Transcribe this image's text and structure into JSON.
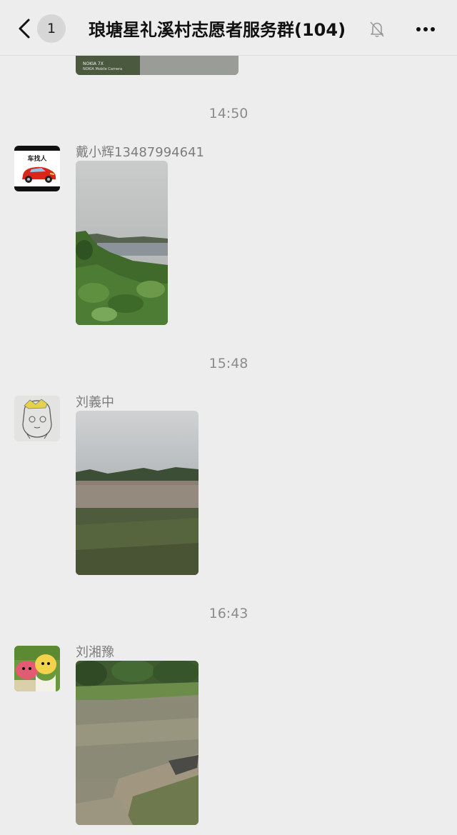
{
  "header": {
    "back_icon": "chevron-left-icon",
    "unread_count": "1",
    "title": "琅塘星礼溪村志愿者服务群(104)",
    "mute_icon": "bell-off-icon",
    "more_icon": "more-dots-icon"
  },
  "previous_photo": {
    "caption_line1": "NOKIA 7X",
    "caption_line2": "NOKIA Mobile Camera"
  },
  "messages": [
    {
      "time": "14:50",
      "sender": "戴小辉13487994641",
      "avatar_text": "车找人"
    },
    {
      "time": "15:48",
      "sender": "刘義中"
    },
    {
      "time": "16:43",
      "sender": "刘湘豫"
    }
  ],
  "colors": {
    "background": "#ededed",
    "timestamp": "#8c8c8c",
    "sender": "#7d7d7d",
    "title": "#111111"
  }
}
